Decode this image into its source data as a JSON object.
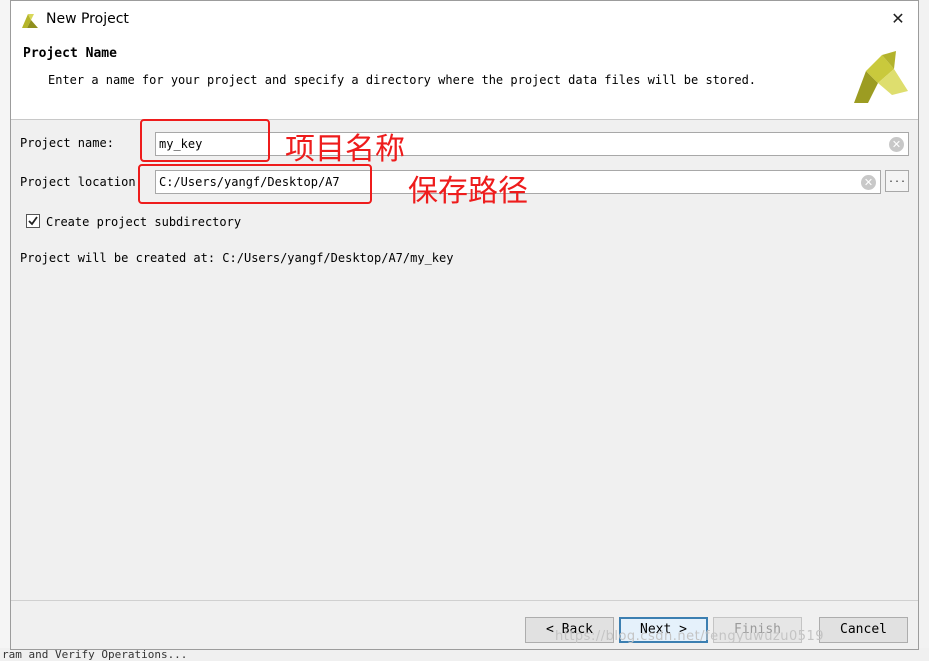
{
  "window": {
    "title": "New Project",
    "close_glyph": "✕"
  },
  "header": {
    "title": "Project Name",
    "description": "Enter a name for your project and specify a directory where the project data files will be stored."
  },
  "form": {
    "name_label": "Project name:",
    "name_value": "my_key",
    "location_label": "Project location:",
    "location_value": "C:/Users/yangf/Desktop/A7",
    "browse_label": "...",
    "subdir_label": "Create project subdirectory",
    "subdir_checked": true,
    "created_at_text": "Project will be created at: C:/Users/yangf/Desktop/A7/my_key"
  },
  "buttons": {
    "back": "< Back",
    "next": "Next >",
    "finish": "Finish",
    "cancel": "Cancel"
  },
  "annotations": {
    "name_note": "项目名称",
    "location_note": "保存路径",
    "color": "#ee1c1c"
  },
  "watermark": "https://blog.csdn.net/fengyuwuzu0519",
  "background_fragments": {
    "bottom_text": "ram and Verify Operations..."
  },
  "icons": [
    "vivado-logo-icon",
    "close-icon",
    "clear-icon",
    "browse-icon",
    "checkmark-icon"
  ]
}
